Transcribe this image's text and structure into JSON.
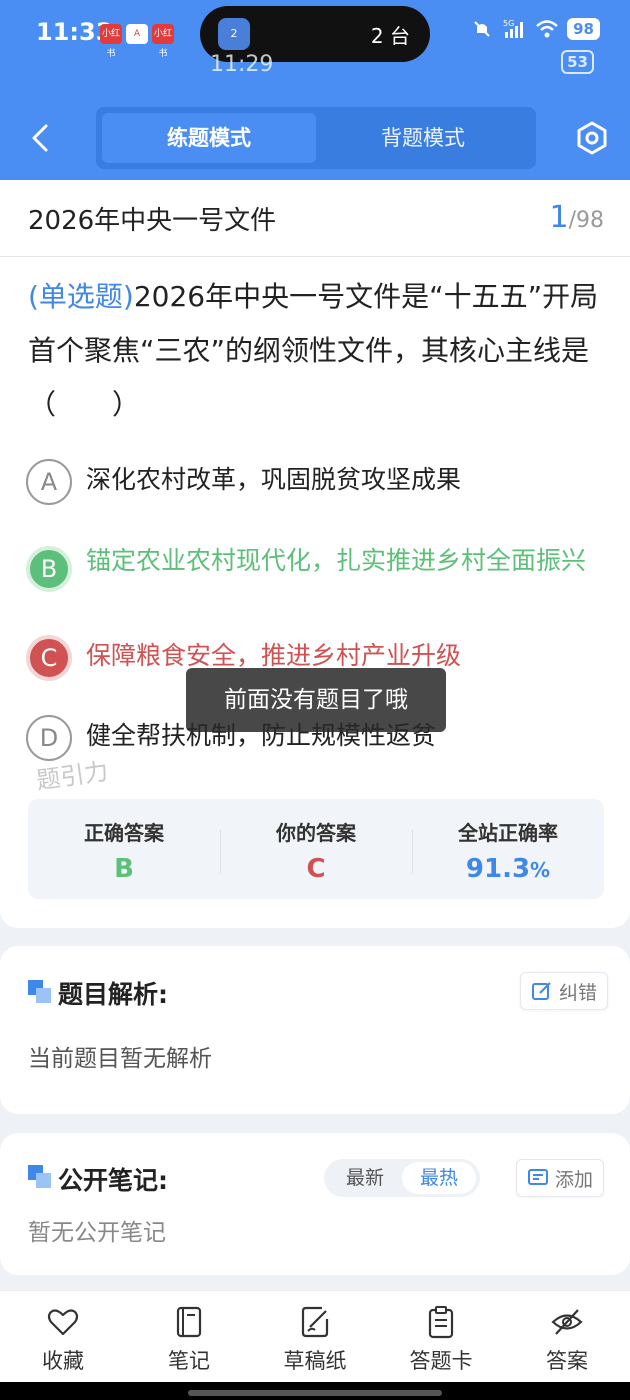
{
  "status_bar": {
    "time": "11:33",
    "ghost_time": "11:29",
    "island_badge": "2",
    "island_text": "2 台",
    "network": "5G",
    "battery": "98",
    "battery_ghost": "53",
    "mini_apps": [
      "小红书",
      "A",
      "小红书"
    ]
  },
  "header": {
    "tabs": [
      {
        "label": "练题模式",
        "active": true
      },
      {
        "label": "背题模式",
        "active": false
      }
    ]
  },
  "question": {
    "doc_title": "2026年中央一号文件",
    "current_index": "1",
    "total": "/98",
    "type_label": "(单选题)",
    "text": "2026年中央一号文件是“十五五”开局首个聚焦“三农”的纲领性文件，其核心主线是（　　）",
    "options": [
      {
        "letter": "A",
        "text": "深化农村改革，巩固脱贫攻坚成果",
        "state": "normal"
      },
      {
        "letter": "B",
        "text": "锚定农业农村现代化，扎实推进乡村全面振兴",
        "state": "correct"
      },
      {
        "letter": "C",
        "text": "保障粮食安全，推进乡村产业升级",
        "state": "wrong"
      },
      {
        "letter": "D",
        "text": "健全帮扶机制，防止规模性返贫",
        "state": "normal"
      }
    ]
  },
  "toast": "前面没有题目了哦",
  "watermark": "题引力",
  "stats": {
    "correct_label": "正确答案",
    "correct_value": "B",
    "yours_label": "你的答案",
    "yours_value": "C",
    "rate_label": "全站正确率",
    "rate_value": "91.3",
    "rate_unit": "%"
  },
  "analysis": {
    "title": "题目解析:",
    "correct_btn": "纠错",
    "body": "当前题目暂无解析"
  },
  "notes": {
    "title": "公开笔记:",
    "sort_options": [
      "最新",
      "最热"
    ],
    "add_btn": "添加",
    "body": "暂无公开笔记"
  },
  "bottom_nav": [
    {
      "label": "收藏",
      "icon": "heart-icon"
    },
    {
      "label": "笔记",
      "icon": "notebook-icon"
    },
    {
      "label": "草稿纸",
      "icon": "draft-icon"
    },
    {
      "label": "答题卡",
      "icon": "clipboard-icon"
    },
    {
      "label": "答案",
      "icon": "eye-off-icon"
    }
  ],
  "colors": {
    "brand": "#4b8ef3",
    "correct": "#5dc07a",
    "wrong": "#d05252",
    "accent_text": "#3f87e8"
  }
}
